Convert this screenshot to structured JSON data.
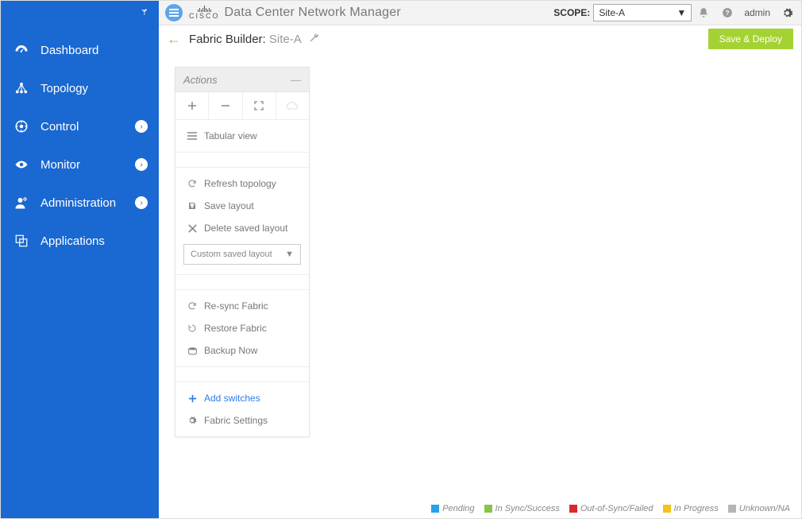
{
  "product_title": "Data Center Network Manager",
  "scope": {
    "label": "SCOPE:",
    "value": "Site-A"
  },
  "user": "admin",
  "subheader": {
    "title": "Fabric Builder:",
    "site": "Site-A",
    "save_button": "Save & Deploy"
  },
  "sidebar": [
    {
      "label": "Dashboard",
      "expandable": false
    },
    {
      "label": "Topology",
      "expandable": false
    },
    {
      "label": "Control",
      "expandable": true
    },
    {
      "label": "Monitor",
      "expandable": true
    },
    {
      "label": "Administration",
      "expandable": true
    },
    {
      "label": "Applications",
      "expandable": false
    }
  ],
  "actions": {
    "title": "Actions",
    "tabular": "Tabular view",
    "refresh": "Refresh topology",
    "save_layout": "Save layout",
    "delete_layout": "Delete saved layout",
    "layout_select": "Custom saved layout",
    "resync": "Re-sync Fabric",
    "restore": "Restore Fabric",
    "backup": "Backup Now",
    "add_switches": "Add switches",
    "fabric_settings": "Fabric Settings"
  },
  "legend": [
    {
      "label": "Pending",
      "color": "#2b9fe8"
    },
    {
      "label": "In Sync/Success",
      "color": "#8bc34a"
    },
    {
      "label": "Out-of-Sync/Failed",
      "color": "#d9292b"
    },
    {
      "label": "In Progress",
      "color": "#f2c318"
    },
    {
      "label": "Unknown/NA",
      "color": "#b5b5b5"
    }
  ]
}
